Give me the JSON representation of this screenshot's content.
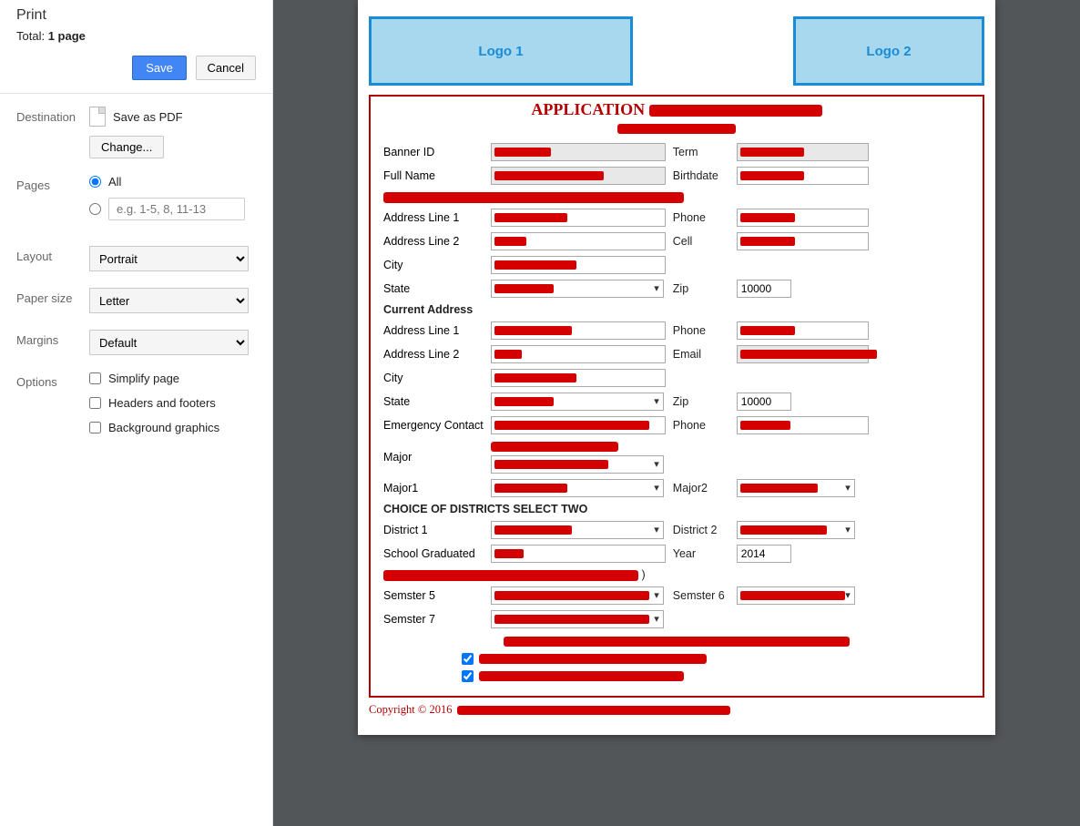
{
  "sidebar": {
    "title": "Print",
    "total_prefix": "Total: ",
    "total_value": "1 page",
    "save_label": "Save",
    "cancel_label": "Cancel",
    "destination_label": "Destination",
    "saveas_label": "Save as PDF",
    "change_label": "Change...",
    "pages_label": "Pages",
    "pages_all_label": "All",
    "pages_range_placeholder": "e.g. 1-5, 8, 11-13",
    "layout_label": "Layout",
    "layout_value": "Portrait",
    "paper_label": "Paper size",
    "paper_value": "Letter",
    "margins_label": "Margins",
    "margins_value": "Default",
    "options_label": "Options",
    "opt_simplify": "Simplify page",
    "opt_headers": "Headers and footers",
    "opt_bg": "Background graphics"
  },
  "doc": {
    "logo1": "Logo 1",
    "logo2": "Logo 2",
    "app_title": "APPLICATION",
    "banner_id": "Banner ID",
    "term": "Term",
    "full_name": "Full Name",
    "birthdate": "Birthdate",
    "addr1": "Address Line 1",
    "addr2": "Address Line 2",
    "phone": "Phone",
    "cell": "Cell",
    "city": "City",
    "state": "State",
    "zip": "Zip",
    "zip_value": "10000",
    "current_addr": "Current Address",
    "email": "Email",
    "emerg": "Emergency Contact",
    "major": "Major",
    "major1": "Major1",
    "major2": "Major2",
    "choice_hdr": "CHOICE OF DISTRICTS SELECT TWO",
    "district1": "District 1",
    "district2": "District 2",
    "school_grad": "School Graduated",
    "year": "Year",
    "year_value": "2014",
    "prev_paren": ")",
    "sem5": "Semster 5",
    "sem6": "Semster 6",
    "sem7": "Semster 7",
    "copyright": "Copyright © 2016"
  }
}
